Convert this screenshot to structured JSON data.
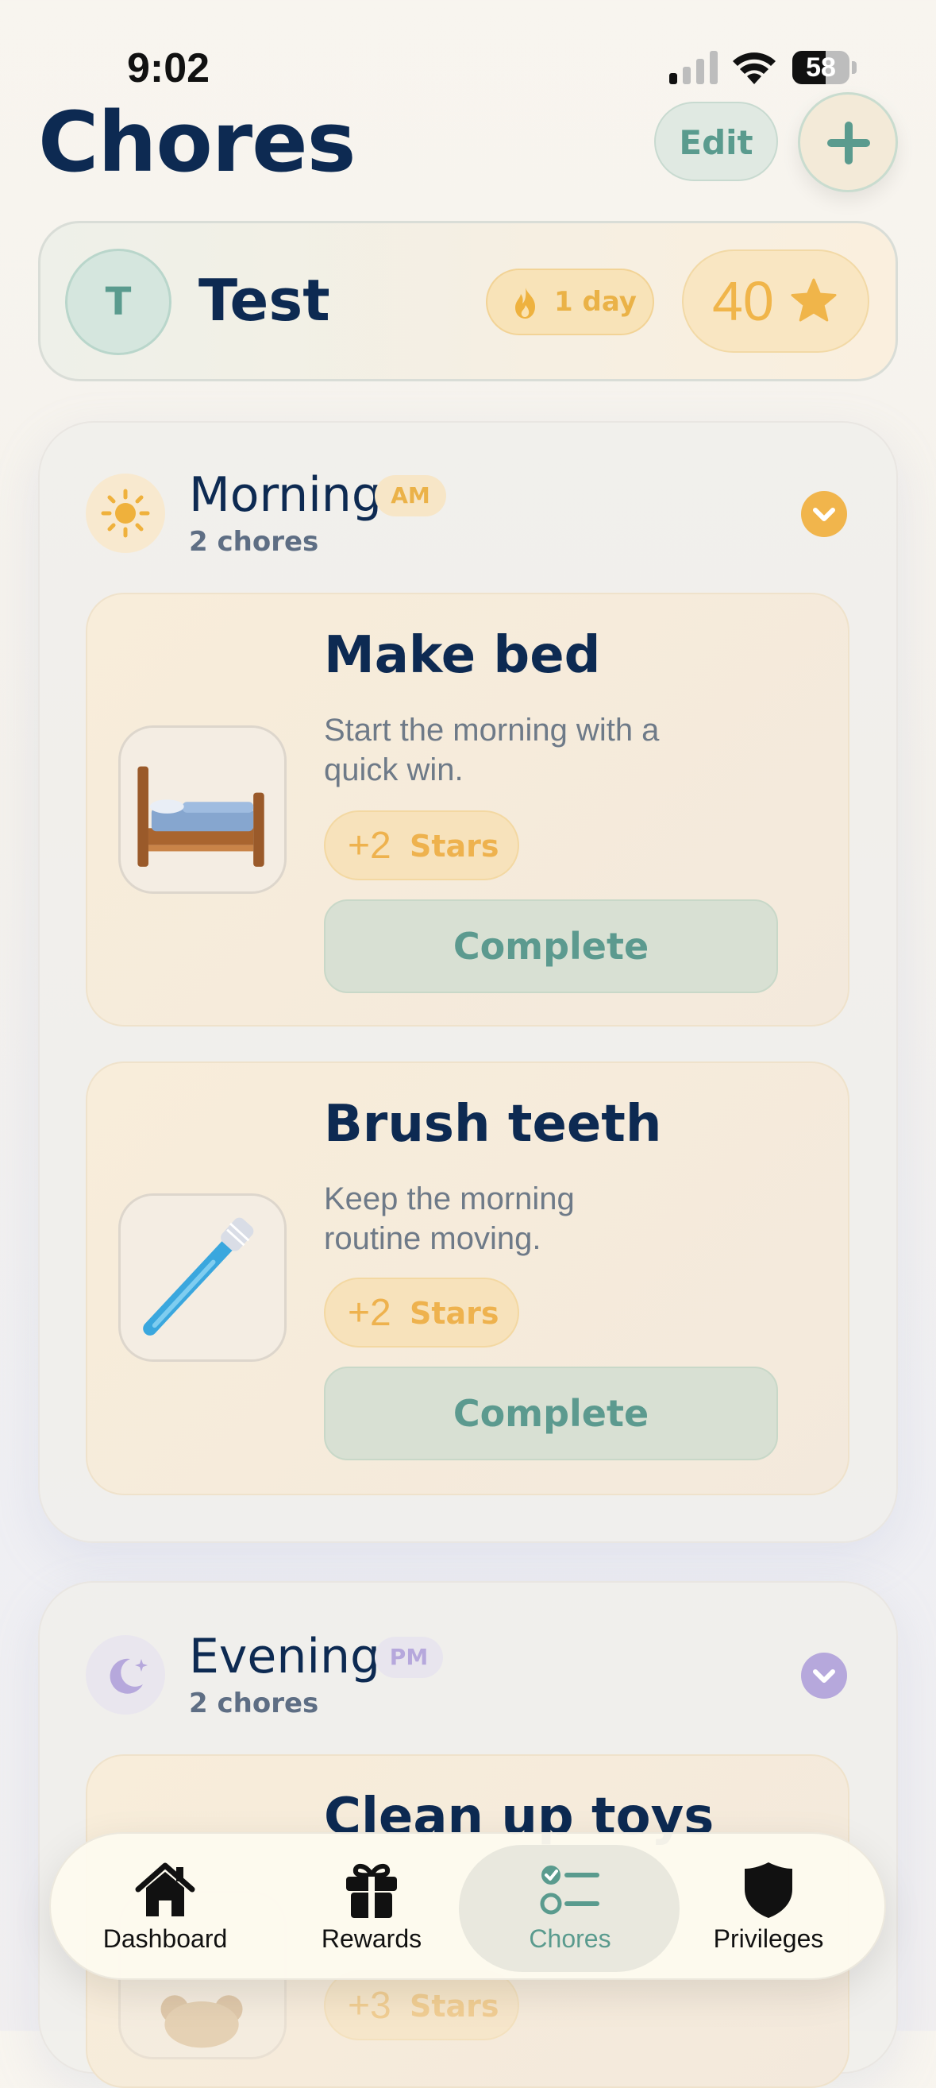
{
  "status_bar": {
    "time": "9:02",
    "battery": "58",
    "battery_level": 0.58
  },
  "header": {
    "title": "Chores",
    "edit_label": "Edit",
    "add_icon": "plus-icon"
  },
  "profile": {
    "initial": "T",
    "name": "Test",
    "streak": "1 day",
    "stars": "40"
  },
  "sections": [
    {
      "title": "Morning",
      "badge": "AM",
      "count": "2 chores",
      "icon": "sun-icon",
      "chores": [
        {
          "title": "Make bed",
          "description": "Start the morning with a quick win.",
          "reward_value": "+2",
          "reward_label": "Stars",
          "action": "Complete",
          "icon": "bed-icon"
        },
        {
          "title": "Brush teeth",
          "description": "Keep the morning routine moving.",
          "reward_value": "+2",
          "reward_label": "Stars",
          "action": "Complete",
          "icon": "toothbrush-icon"
        }
      ]
    },
    {
      "title": "Evening",
      "badge": "PM",
      "count": "2 chores",
      "icon": "moon-icon",
      "chores": [
        {
          "title": "Clean up toys",
          "reward_value": "+3",
          "reward_label": "Stars",
          "icon": "teddy-bear-icon"
        }
      ]
    }
  ],
  "tabbar": {
    "items": [
      {
        "label": "Dashboard",
        "icon": "house-icon"
      },
      {
        "label": "Rewards",
        "icon": "gift-icon"
      },
      {
        "label": "Chores",
        "icon": "checklist-icon",
        "active": true
      },
      {
        "label": "Privileges",
        "icon": "shield-icon"
      }
    ]
  },
  "colors": {
    "navy": "#0d2a52",
    "teal": "#5a9b8e",
    "amber": "#f0b54a",
    "lavender": "#b6a8dc"
  }
}
